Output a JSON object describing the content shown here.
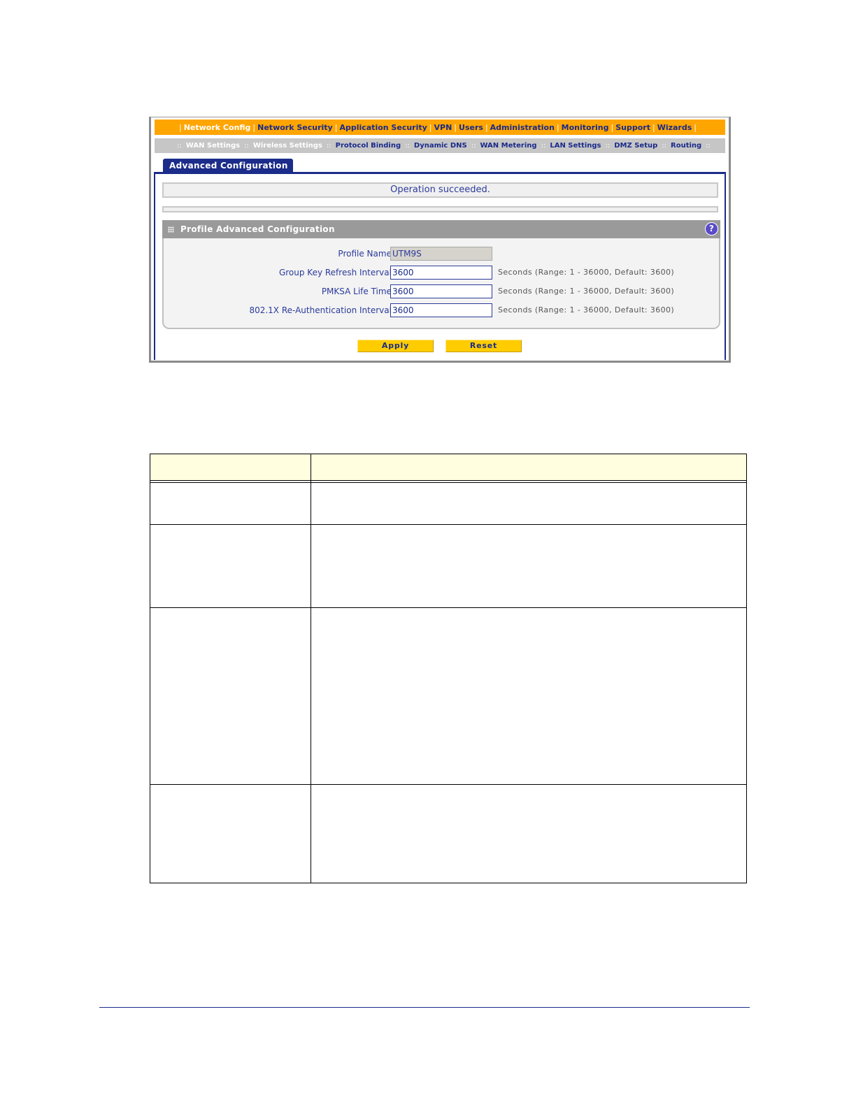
{
  "nav": {
    "primary": [
      "Network Config",
      "Network Security",
      "Application Security",
      "VPN",
      "Users",
      "Administration",
      "Monitoring",
      "Support",
      "Wizards"
    ],
    "primary_active": "Network Config",
    "secondary": [
      "WAN Settings",
      "Wireless Settings",
      "Protocol Binding",
      "Dynamic DNS",
      "WAN Metering",
      "LAN Settings",
      "DMZ Setup",
      "Routing"
    ],
    "secondary_active": [
      "WAN Settings",
      "Wireless Settings"
    ]
  },
  "tab": {
    "label": "Advanced Configuration"
  },
  "status": {
    "message": "Operation succeeded."
  },
  "section": {
    "title": "Profile Advanced Configuration",
    "help_icon": "?",
    "fields": [
      {
        "label": "Profile Name:",
        "value": "UTM9S",
        "hint": "",
        "readonly": true
      },
      {
        "label": "Group Key Refresh Interval:",
        "value": "3600",
        "hint": "Seconds (Range: 1 - 36000, Default: 3600)",
        "readonly": false
      },
      {
        "label": "PMKSA Life Time:",
        "value": "3600",
        "hint": "Seconds (Range: 1 - 36000, Default: 3600)",
        "readonly": false
      },
      {
        "label": "802.1X Re-Authentication Interval:",
        "value": "3600",
        "hint": "Seconds (Range: 1 - 36000, Default: 3600)",
        "readonly": false
      }
    ]
  },
  "buttons": {
    "apply": "Apply",
    "reset": "Reset"
  },
  "colors": {
    "nav_orange": "#ffa500",
    "nav_text": "#1a2a8a",
    "subnav_gray": "#c6c6c6",
    "tab_blue": "#1b2c8a",
    "button_yellow": "#ffcc00",
    "table_header": "#ffffe0"
  }
}
